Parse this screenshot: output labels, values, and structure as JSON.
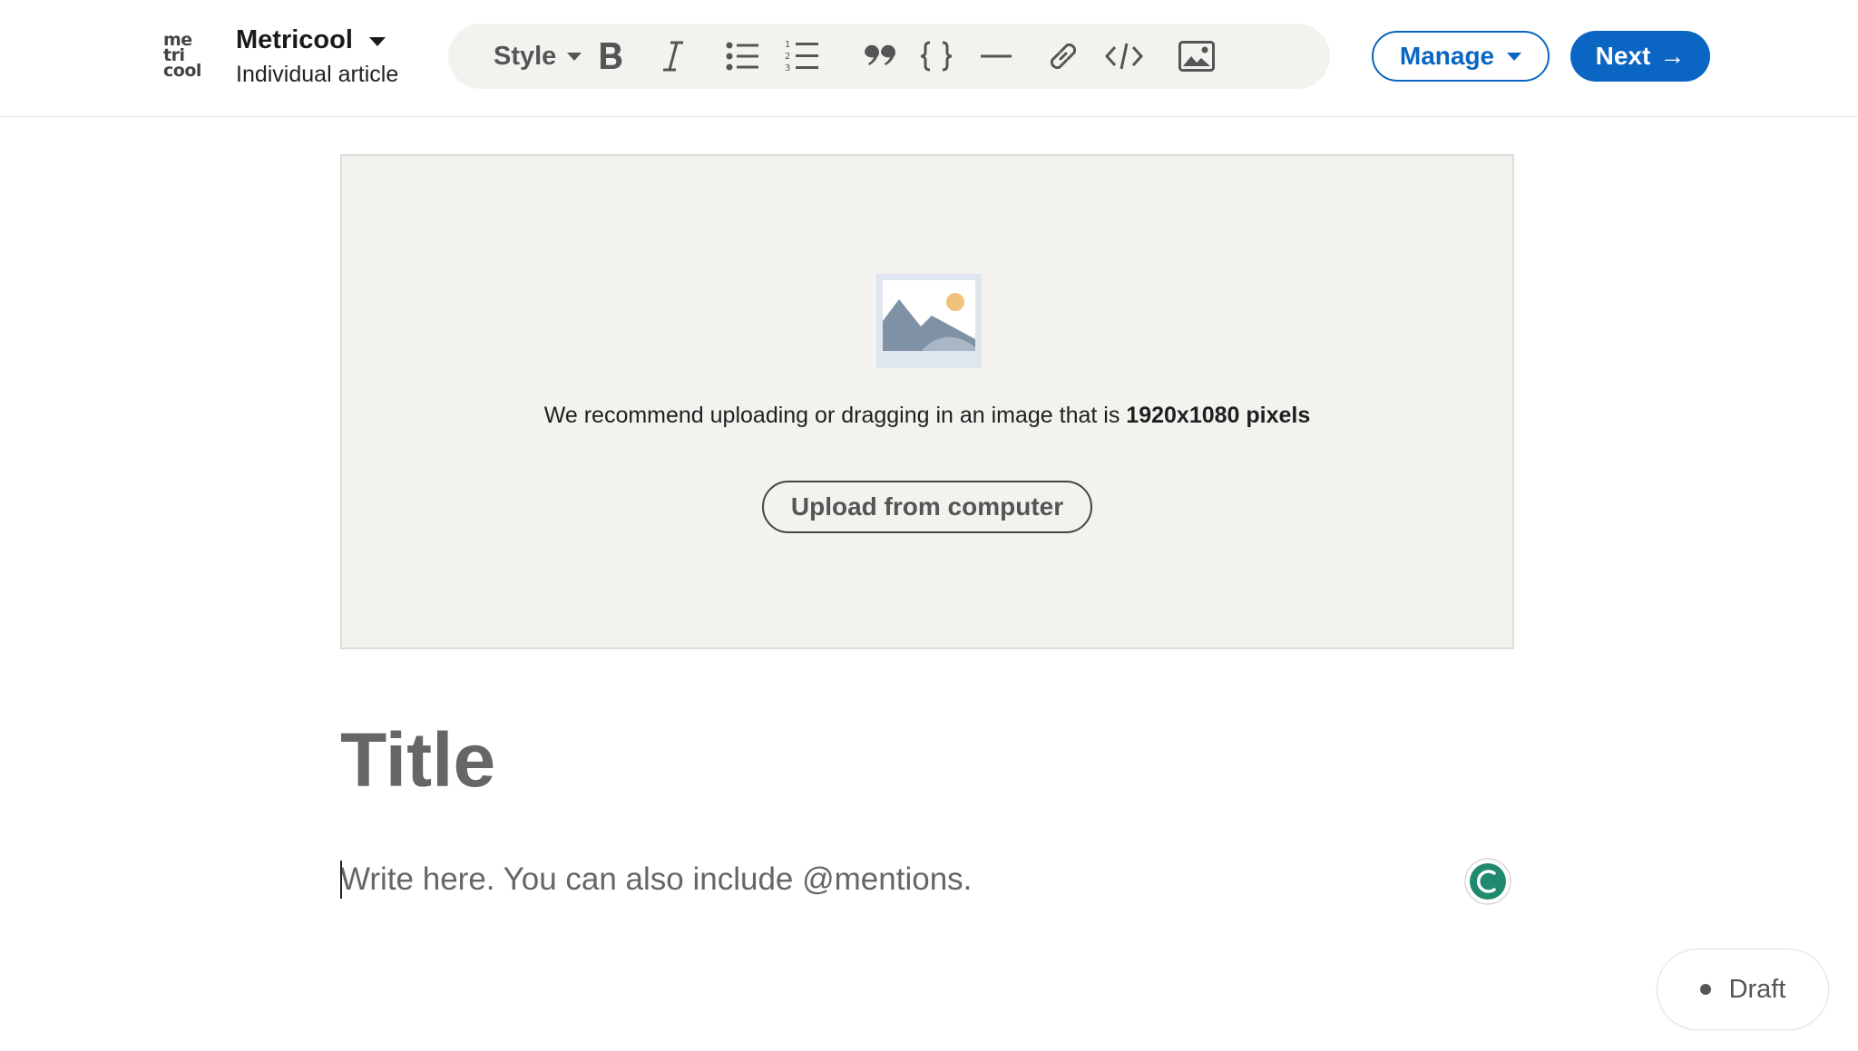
{
  "header": {
    "logo_lines": [
      "me",
      "tri",
      "cool"
    ],
    "author_name": "Metricool",
    "author_subtitle": "Individual article"
  },
  "toolbar": {
    "style_label": "Style",
    "icons": [
      "bold-icon",
      "italic-icon",
      "bulleted-list-icon",
      "numbered-list-icon",
      "quote-icon",
      "code-block-icon",
      "divider-icon",
      "link-icon",
      "embed-code-icon",
      "image-icon"
    ]
  },
  "actions": {
    "manage_label": "Manage",
    "next_label": "Next",
    "next_arrow": "→",
    "accent_color": "#0a66c2"
  },
  "cover": {
    "recommend_text": "We recommend uploading or dragging in an image that is ",
    "recommend_bold": "1920x1080 pixels",
    "upload_label": "Upload from computer"
  },
  "editor": {
    "title_placeholder": "Title",
    "body_placeholder": "Write here. You can also include @mentions."
  },
  "status": {
    "label": "Draft"
  }
}
